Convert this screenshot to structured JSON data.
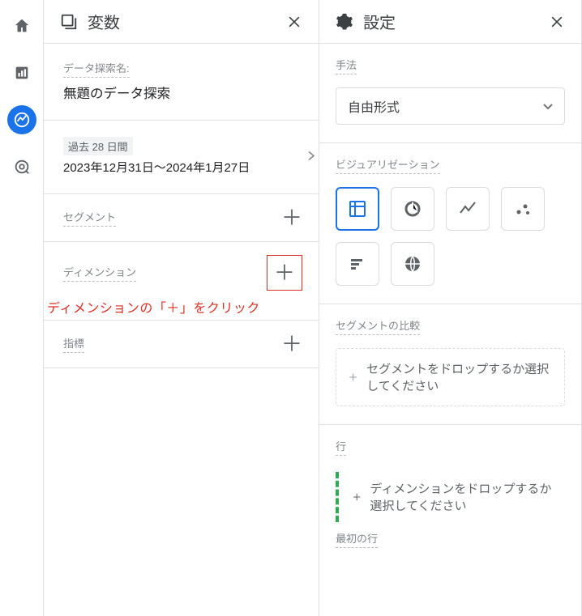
{
  "nav": {
    "items": [
      {
        "name": "home-icon"
      },
      {
        "name": "bar-chart-icon"
      },
      {
        "name": "explore-icon",
        "active": true
      },
      {
        "name": "target-icon"
      }
    ]
  },
  "vars_panel": {
    "title": "変数",
    "exploration_name_label": "データ探索名:",
    "exploration_name_value": "無題のデータ探索",
    "date_badge": "過去 28 日間",
    "date_range": "2023年12月31日～2024年1月27日",
    "segments_label": "セグメント",
    "dimensions_label": "ディメンション",
    "dimensions_annotation": "ディメンションの「＋」をクリック",
    "metrics_label": "指標",
    "plus_glyph": "＋"
  },
  "settings_panel": {
    "title": "設定",
    "method_label": "手法",
    "method_value": "自由形式",
    "viz_label": "ビジュアリゼーション",
    "viz_options": [
      {
        "name": "table-viz-icon",
        "selected": true
      },
      {
        "name": "donut-viz-icon"
      },
      {
        "name": "line-viz-icon"
      },
      {
        "name": "scatter-viz-icon"
      },
      {
        "name": "bar-viz-icon"
      },
      {
        "name": "geo-viz-icon"
      }
    ],
    "segment_compare_label": "セグメントの比較",
    "segment_drop_text": "セグメントをドロップするか選択してください",
    "rows_label": "行",
    "rows_drop_text": "ディメンションをドロップするか選択してください",
    "cutoff_label": "最初の行"
  }
}
